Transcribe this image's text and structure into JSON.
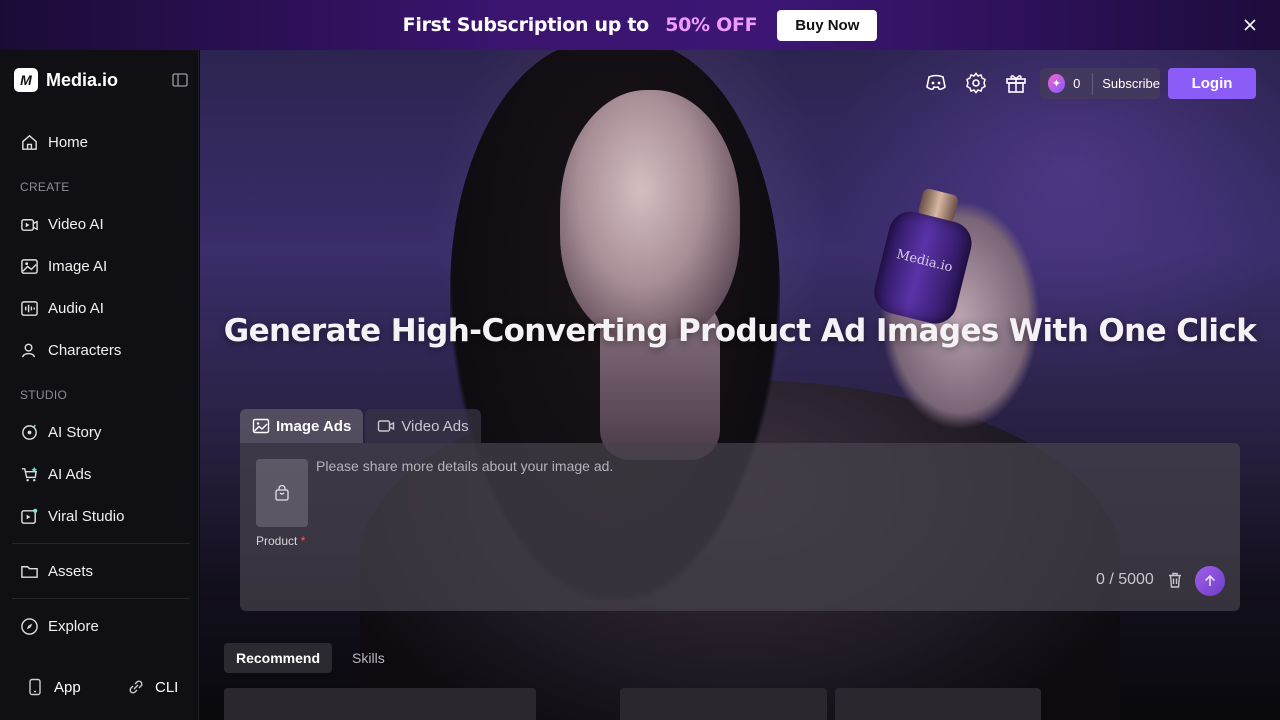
{
  "promo": {
    "text": "First Subscription up to",
    "offer": "50% OFF",
    "button": "Buy Now"
  },
  "brand": {
    "name": "Media.io",
    "logo_letter": "M"
  },
  "sidebar": {
    "home": "Home",
    "section_create": "CREATE",
    "create_items": [
      "Video AI",
      "Image AI",
      "Audio AI",
      "Characters"
    ],
    "section_studio": "STUDIO",
    "studio_items": [
      "AI Story",
      "AI Ads",
      "Viral Studio"
    ],
    "assets": "Assets",
    "explore": "Explore",
    "footer": {
      "app": "App",
      "cli": "CLI"
    }
  },
  "toolbar": {
    "icons": [
      "discord-icon",
      "gear-icon",
      "gift-icon"
    ],
    "credits": "0",
    "subscribe": "Subscribe",
    "login": "Login"
  },
  "hero": {
    "headline": "Generate High-Converting Product Ad Images With One Click",
    "bottle_label": "Media.io"
  },
  "composer": {
    "tabs": [
      "Image Ads",
      "Video Ads"
    ],
    "active_tab": "Image Ads",
    "placeholder": "Please share more details about your image ad.",
    "product_label": "Product",
    "required_mark": "*",
    "counter": "0 / 5000"
  },
  "gallery": {
    "tabs": [
      "Recommend",
      "Skills"
    ],
    "active_tab": "Recommend"
  },
  "colors": {
    "accent": "#8b5cf6",
    "required": "#ff5a5a",
    "offer": "#f09bff"
  }
}
